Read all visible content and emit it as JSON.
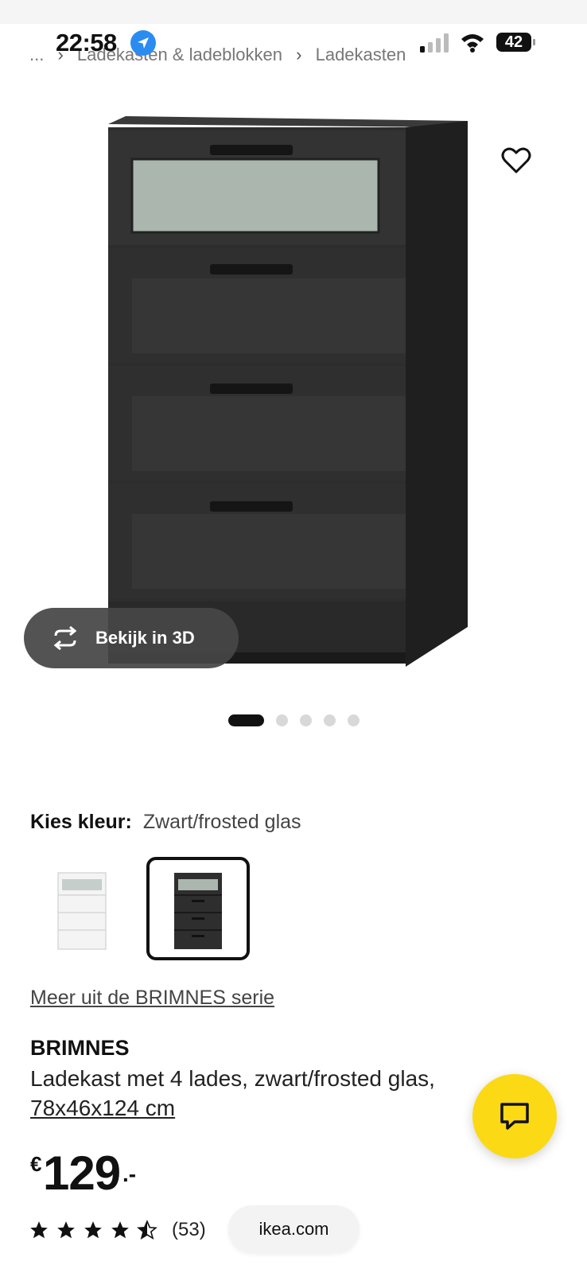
{
  "status_bar": {
    "time": "22:58",
    "battery": "42",
    "icons": [
      "location-icon",
      "signal-icon",
      "wifi-icon",
      "battery-icon"
    ]
  },
  "breadcrumb": {
    "ellipsis": "...",
    "items": [
      "Ladekasten & ladeblokken",
      "Ladekasten"
    ]
  },
  "gallery": {
    "favorite_icon": "heart-outline-icon",
    "view_3d_label": "Bekijk in 3D",
    "view_3d_icon": "rotate-3d-icon",
    "images_total": 5,
    "active_index": 0
  },
  "colour": {
    "label": "Kies kleur:",
    "selected": "Zwart/frosted glas",
    "swatches": [
      {
        "name": "white",
        "selected": false
      },
      {
        "name": "black",
        "selected": true
      }
    ]
  },
  "series_link": "Meer uit de BRIMNES serie",
  "product": {
    "name": "BRIMNES",
    "description": "Ladekast met 4 lades, zwart/frosted glas,",
    "size": "78x46x124 cm",
    "price": {
      "currency": "€",
      "amount": "129",
      "decimals": ".-"
    },
    "rating": {
      "stars": 4.5,
      "count": "(53)"
    }
  },
  "chat_icon": "chat-bubble-icon",
  "browser": {
    "url": "ikea.com"
  },
  "colors": {
    "accent_yellow": "#fbd914",
    "location_blue": "#2a8cf1",
    "product_black": "#2b2b2b"
  }
}
